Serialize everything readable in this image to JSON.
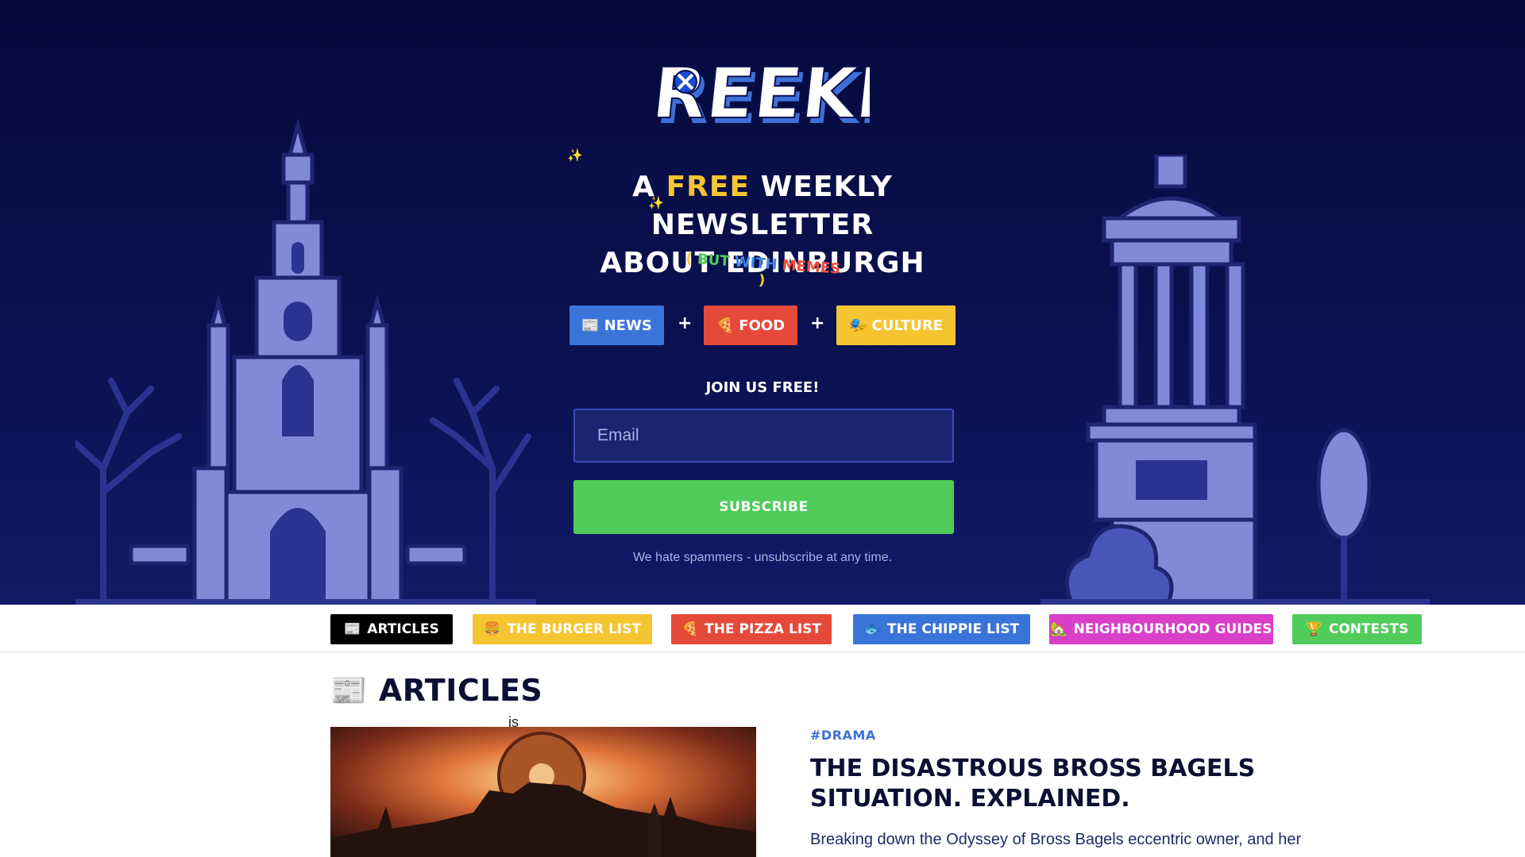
{
  "logo": {
    "text": "Reekie",
    "flag_icon": "saltire-icon"
  },
  "hero": {
    "tagline_pre": "A",
    "tagline_highlight": "FREE",
    "tagline_post": "WEEKLY NEWSLETTER",
    "tagline_line2": "ABOUT EDINBURGH",
    "memes": {
      "open": "(",
      "w1": "BUT",
      "w2": "WITH",
      "w3": "MEMES",
      "close": ")"
    },
    "chips": [
      {
        "icon": "📰",
        "label": "NEWS",
        "color": "#3b74d9"
      },
      {
        "icon": "🍕",
        "label": "FOOD",
        "color": "#e5493a"
      },
      {
        "icon": "🎭",
        "label": "CULTURE",
        "color": "#f5c531"
      }
    ],
    "plus": "+",
    "join_label": "JOIN US FREE!",
    "email_placeholder": "Email",
    "subscribe_label": "SUBSCRIBE",
    "spam_note": "We hate spammers - unsubscribe at any time."
  },
  "nav": {
    "items": [
      {
        "icon": "📰",
        "label": "ARTICLES",
        "color": "#000000"
      },
      {
        "icon": "🍔",
        "label": "THE BURGER LIST",
        "color": "#f5c531"
      },
      {
        "icon": "🍕",
        "label": "THE PIZZA LIST",
        "color": "#e5493a"
      },
      {
        "icon": "🐟",
        "label": "THE CHIPPIE LIST",
        "color": "#3b74d9"
      },
      {
        "icon": "🏡",
        "label": "NEIGHBOURHOOD GUIDES",
        "color": "#d93fc9"
      },
      {
        "icon": "🏆",
        "label": "CONTESTS",
        "color": "#50cc5a"
      }
    ]
  },
  "content": {
    "section_icon": "📰",
    "section_title": "ARTICLES",
    "stray_text": "is",
    "article": {
      "tag": "#DRAMA",
      "title": "THE DISASTROUS BROSS BAGELS SITUATION. EXPLAINED.",
      "excerpt": "Breaking down the Odyssey of Bross Bagels eccentric owner, and her"
    }
  }
}
